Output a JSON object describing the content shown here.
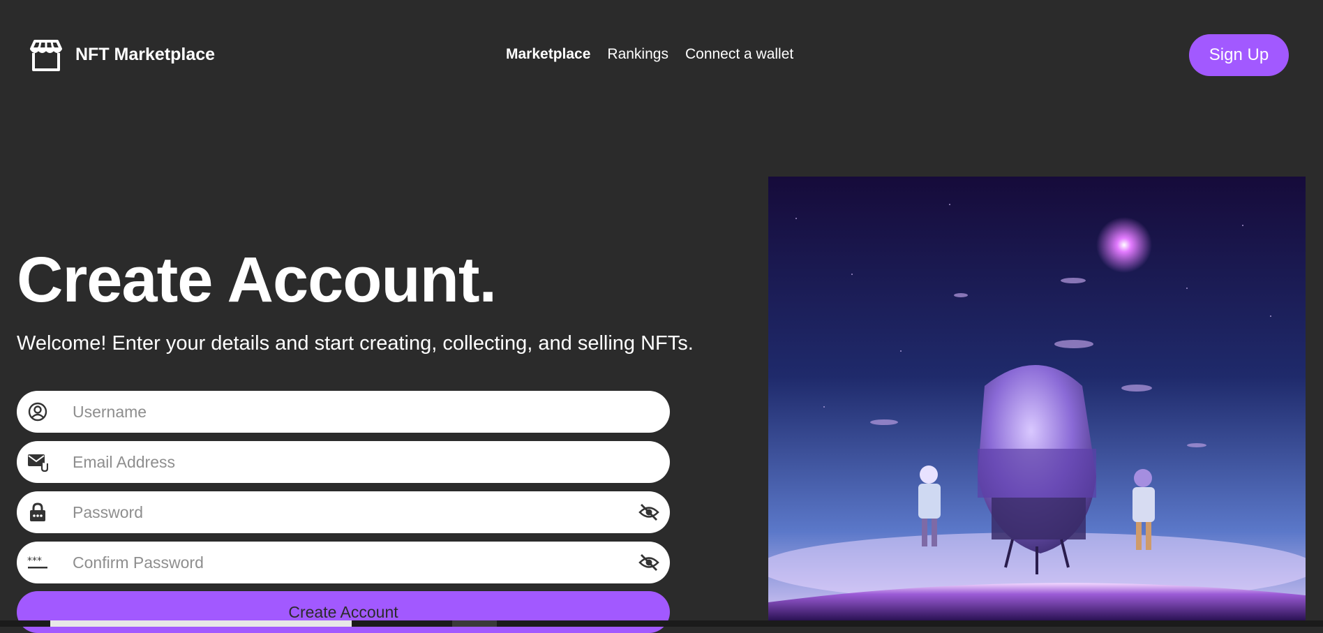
{
  "header": {
    "brand": "NFT Marketplace",
    "nav": [
      {
        "label": "Marketplace",
        "active": true
      },
      {
        "label": "Rankings",
        "active": false
      },
      {
        "label": "Connect a wallet",
        "active": false
      }
    ],
    "signup_label": "Sign Up"
  },
  "main": {
    "title": "Create Account.",
    "subtitle": "Welcome! Enter your details and start creating, collecting, and selling NFTs.",
    "fields": {
      "username": {
        "placeholder": "Username",
        "icon": "user-circle-icon"
      },
      "email": {
        "placeholder": "Email Address",
        "icon": "mail-icon"
      },
      "password": {
        "placeholder": "Password",
        "icon": "lock-icon",
        "toggle_icon": "eye-off-icon"
      },
      "confirm": {
        "placeholder": "Confirm Password",
        "icon": "password-dots-icon",
        "toggle_icon": "eye-off-icon"
      }
    },
    "submit_label": "Create Account"
  },
  "colors": {
    "background": "#2b2b2b",
    "accent": "#a259ff",
    "field": "#ffffff"
  }
}
